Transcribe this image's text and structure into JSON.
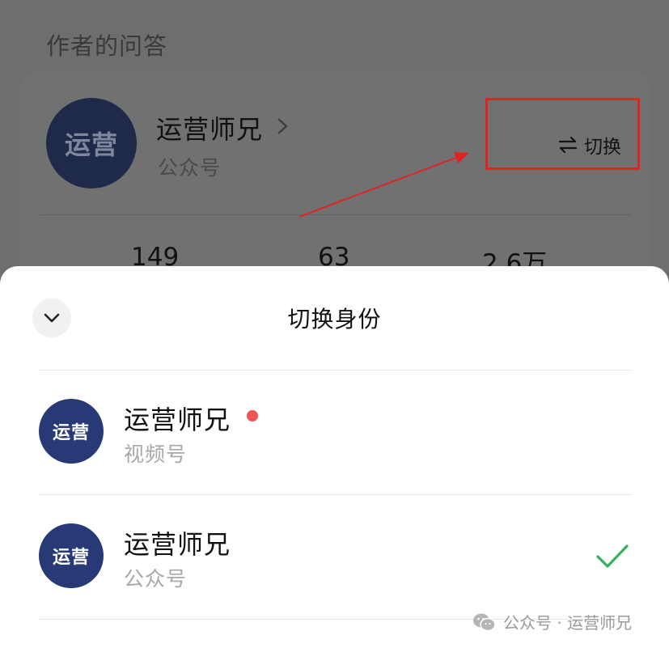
{
  "background_page": {
    "section_title": "作者的问答",
    "author": {
      "avatar_text": "运营",
      "name": "运营师兄",
      "account_type": "公众号",
      "switch_label": "切换"
    },
    "stats": [
      "149",
      "63",
      "2.6万"
    ]
  },
  "sheet": {
    "title": "切换身份",
    "accounts": [
      {
        "avatar_text": "运营",
        "name": "运营师兄",
        "type": "视频号",
        "has_notification_dot": true,
        "selected": false
      },
      {
        "avatar_text": "运营",
        "name": "运营师兄",
        "type": "公众号",
        "has_notification_dot": false,
        "selected": true
      }
    ]
  },
  "watermark": {
    "text": "公众号 · 运营师兄"
  },
  "colors": {
    "highlight_red": "#e02424",
    "avatar_blue": "#283a75",
    "check_green": "#34b15c",
    "dot_red": "#f25454"
  }
}
